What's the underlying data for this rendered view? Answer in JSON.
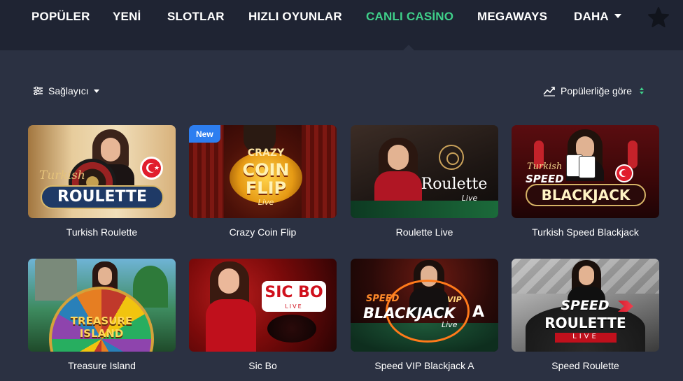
{
  "nav": {
    "items": [
      {
        "label": "POPÜLER"
      },
      {
        "label": "YENİ"
      },
      {
        "label": "SLOTLAR"
      },
      {
        "label": "HIZLI OYUNLAR"
      },
      {
        "label": "CANLI CASİNO"
      },
      {
        "label": "MEGAWAYS"
      },
      {
        "label": "DAHA"
      }
    ],
    "active_index": 4,
    "accent_color": "#3fd08a"
  },
  "toolbar": {
    "provider_label": "Sağlayıcı",
    "sort_label": "Popülerliğe göre"
  },
  "games": [
    {
      "title": "Turkish Roulette",
      "logo_script": "Turkish",
      "logo_main": "ROULETTE"
    },
    {
      "title": "Crazy Coin Flip",
      "badge": "New",
      "logo_line1": "CRAZY",
      "logo_line2": "COIN",
      "logo_line3": "FLIP",
      "logo_sub": "Live"
    },
    {
      "title": "Roulette Live",
      "logo_main": "Roulette",
      "logo_sub": "Live"
    },
    {
      "title": "Turkish Speed Blackjack",
      "logo_script": "Turkish",
      "logo_line1": "SPEED",
      "logo_main": "BLACKJACK"
    },
    {
      "title": "Treasure Island",
      "logo_line1": "TREASURE",
      "logo_line2": "ISLAND"
    },
    {
      "title": "Sic Bo",
      "logo_main": "SIC BO",
      "logo_sub": "LIVE"
    },
    {
      "title": "Speed VIP Blackjack A",
      "logo_line1": "SPEED",
      "logo_vip": "VIP",
      "logo_main": "BLACKJACK",
      "logo_a": "A",
      "logo_sub": "Live"
    },
    {
      "title": "Speed Roulette",
      "logo_line1": "SPEED",
      "logo_main": "ROULETTE",
      "logo_sub": "LIVE"
    }
  ]
}
